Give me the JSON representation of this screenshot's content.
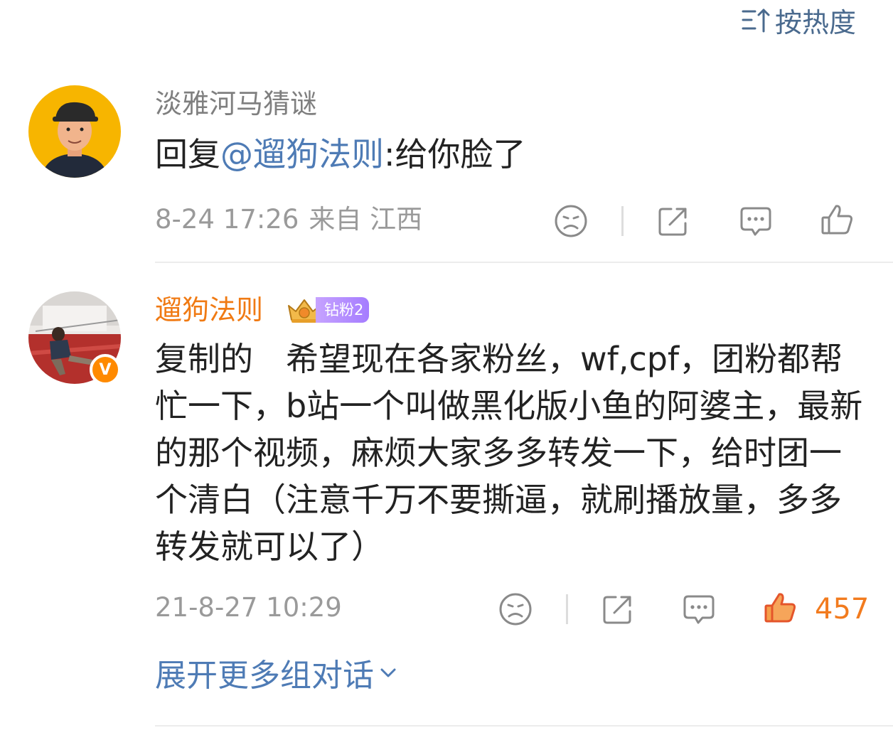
{
  "sort": {
    "label": "按热度"
  },
  "comments": [
    {
      "username": "淡雅河马猜谜",
      "text_prefix": "回复",
      "mention": "@遛狗法则",
      "text_suffix": ":给你脸了",
      "date": "8-24 17:26",
      "location": "来自 江西"
    },
    {
      "username": "遛狗法则",
      "badge": "钻粉2",
      "verified_mark": "V",
      "text": "复制的　希望现在各家粉丝，wf,cpf，团粉都帮忙一下，b站一个叫做黑化版小鱼的阿婆主，最新的那个视频，麻烦大家多多转发一下，给时团一个清白（注意千万不要撕逼，就刷播放量，多多转发就可以了）",
      "date": "21-8-27 10:29",
      "likes": "457"
    }
  ],
  "more": {
    "label": "展开更多组对话"
  },
  "colors": {
    "link": "#4e7bb5",
    "vip_name": "#f07a13",
    "like_active": "#f27b1e",
    "meta": "#9a9a9a",
    "icon": "#8a8a8a"
  }
}
